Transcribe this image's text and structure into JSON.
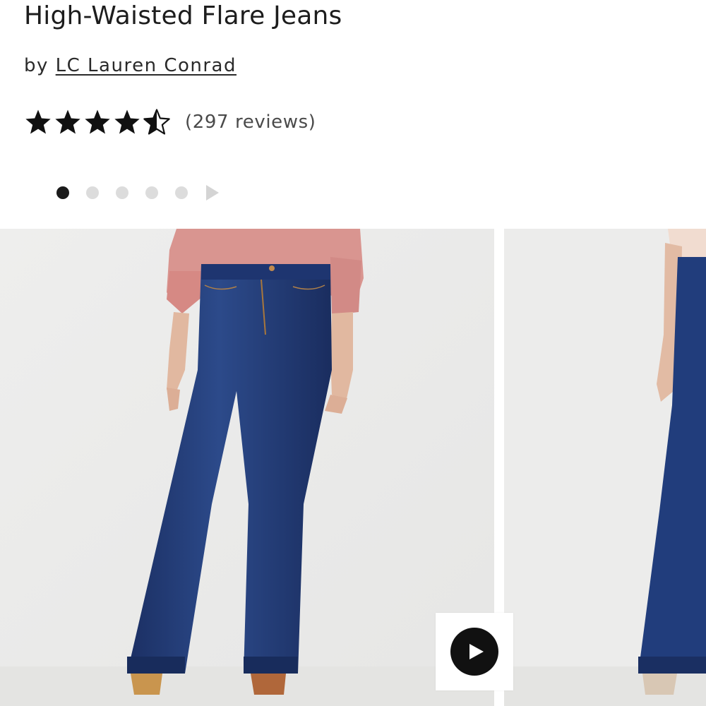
{
  "product": {
    "title": "High-Waisted Flare Jeans",
    "by_prefix": "by",
    "brand": "LC Lauren Conrad",
    "rating": 4.5,
    "rating_max": 5,
    "reviews_text": "(297 reviews)"
  },
  "carousel": {
    "dot_count": 5,
    "active_index": 0,
    "next_icon": "triangle-right-icon"
  },
  "gallery": {
    "slides": [
      {
        "name": "model-front-view"
      },
      {
        "name": "model-side-view"
      }
    ],
    "video_icon": "play-icon"
  },
  "colors": {
    "text": "#1d1d1d",
    "star": "#111111",
    "dot_active": "#1a1a1a",
    "dot_inactive": "#dcdcdc",
    "denim": "#203a77",
    "top": "#d99590",
    "background": "#ededec"
  }
}
